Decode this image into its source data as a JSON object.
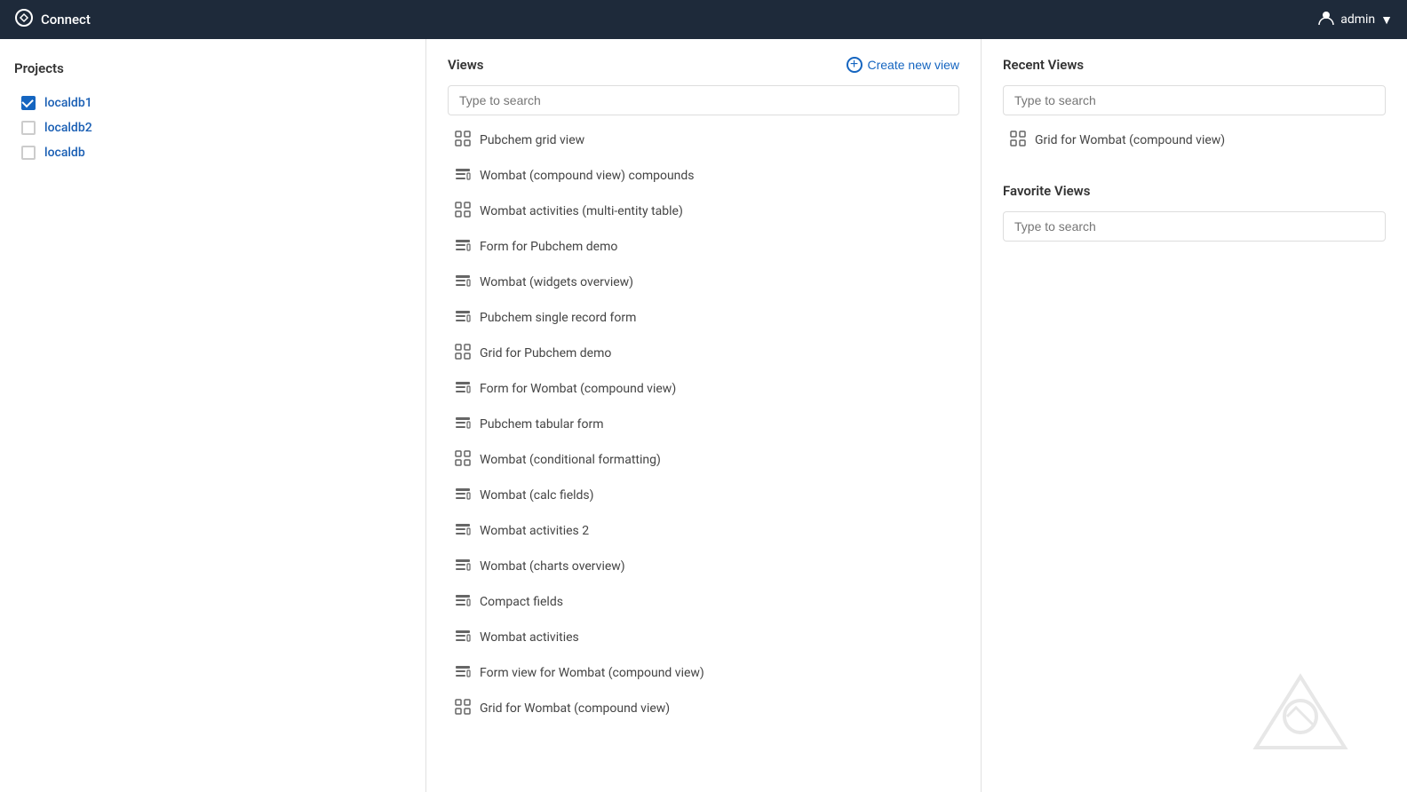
{
  "topnav": {
    "logo_label": "Connect",
    "user_label": "admin",
    "user_icon": "▼"
  },
  "sidebar": {
    "title": "Projects",
    "projects": [
      {
        "name": "localdb1",
        "checked": true
      },
      {
        "name": "localdb2",
        "checked": false
      },
      {
        "name": "localdb",
        "checked": false
      }
    ]
  },
  "views": {
    "title": "Views",
    "create_btn_label": "Create new view",
    "search_placeholder": "Type to search",
    "items": [
      {
        "name": "Pubchem grid view",
        "type": "grid"
      },
      {
        "name": "Wombat (compound view) compounds",
        "type": "form"
      },
      {
        "name": "Wombat activities (multi-entity table)",
        "type": "grid"
      },
      {
        "name": "Form for Pubchem demo",
        "type": "form"
      },
      {
        "name": "Wombat (widgets overview)",
        "type": "form"
      },
      {
        "name": "Pubchem single record form",
        "type": "form"
      },
      {
        "name": "Grid for Pubchem demo",
        "type": "grid"
      },
      {
        "name": "Form for Wombat (compound view)",
        "type": "form"
      },
      {
        "name": "Pubchem tabular form",
        "type": "form"
      },
      {
        "name": "Wombat (conditional formatting)",
        "type": "grid"
      },
      {
        "name": "Wombat (calc fields)",
        "type": "form"
      },
      {
        "name": "Wombat activities 2",
        "type": "form"
      },
      {
        "name": "Wombat (charts overview)",
        "type": "form"
      },
      {
        "name": "Compact fields",
        "type": "form"
      },
      {
        "name": "Wombat activities",
        "type": "form"
      },
      {
        "name": "Form view for Wombat (compound view)",
        "type": "form"
      },
      {
        "name": "Grid for Wombat (compound view)",
        "type": "grid"
      }
    ]
  },
  "recent_views": {
    "title": "Recent Views",
    "search_placeholder": "Type to search",
    "items": [
      {
        "name": "Grid for Wombat (compound view)",
        "type": "grid"
      }
    ]
  },
  "favorite_views": {
    "title": "Favorite Views",
    "search_placeholder": "Type to search",
    "items": []
  },
  "colors": {
    "accent": "#1565c0",
    "nav_bg": "#1e2a3a"
  }
}
